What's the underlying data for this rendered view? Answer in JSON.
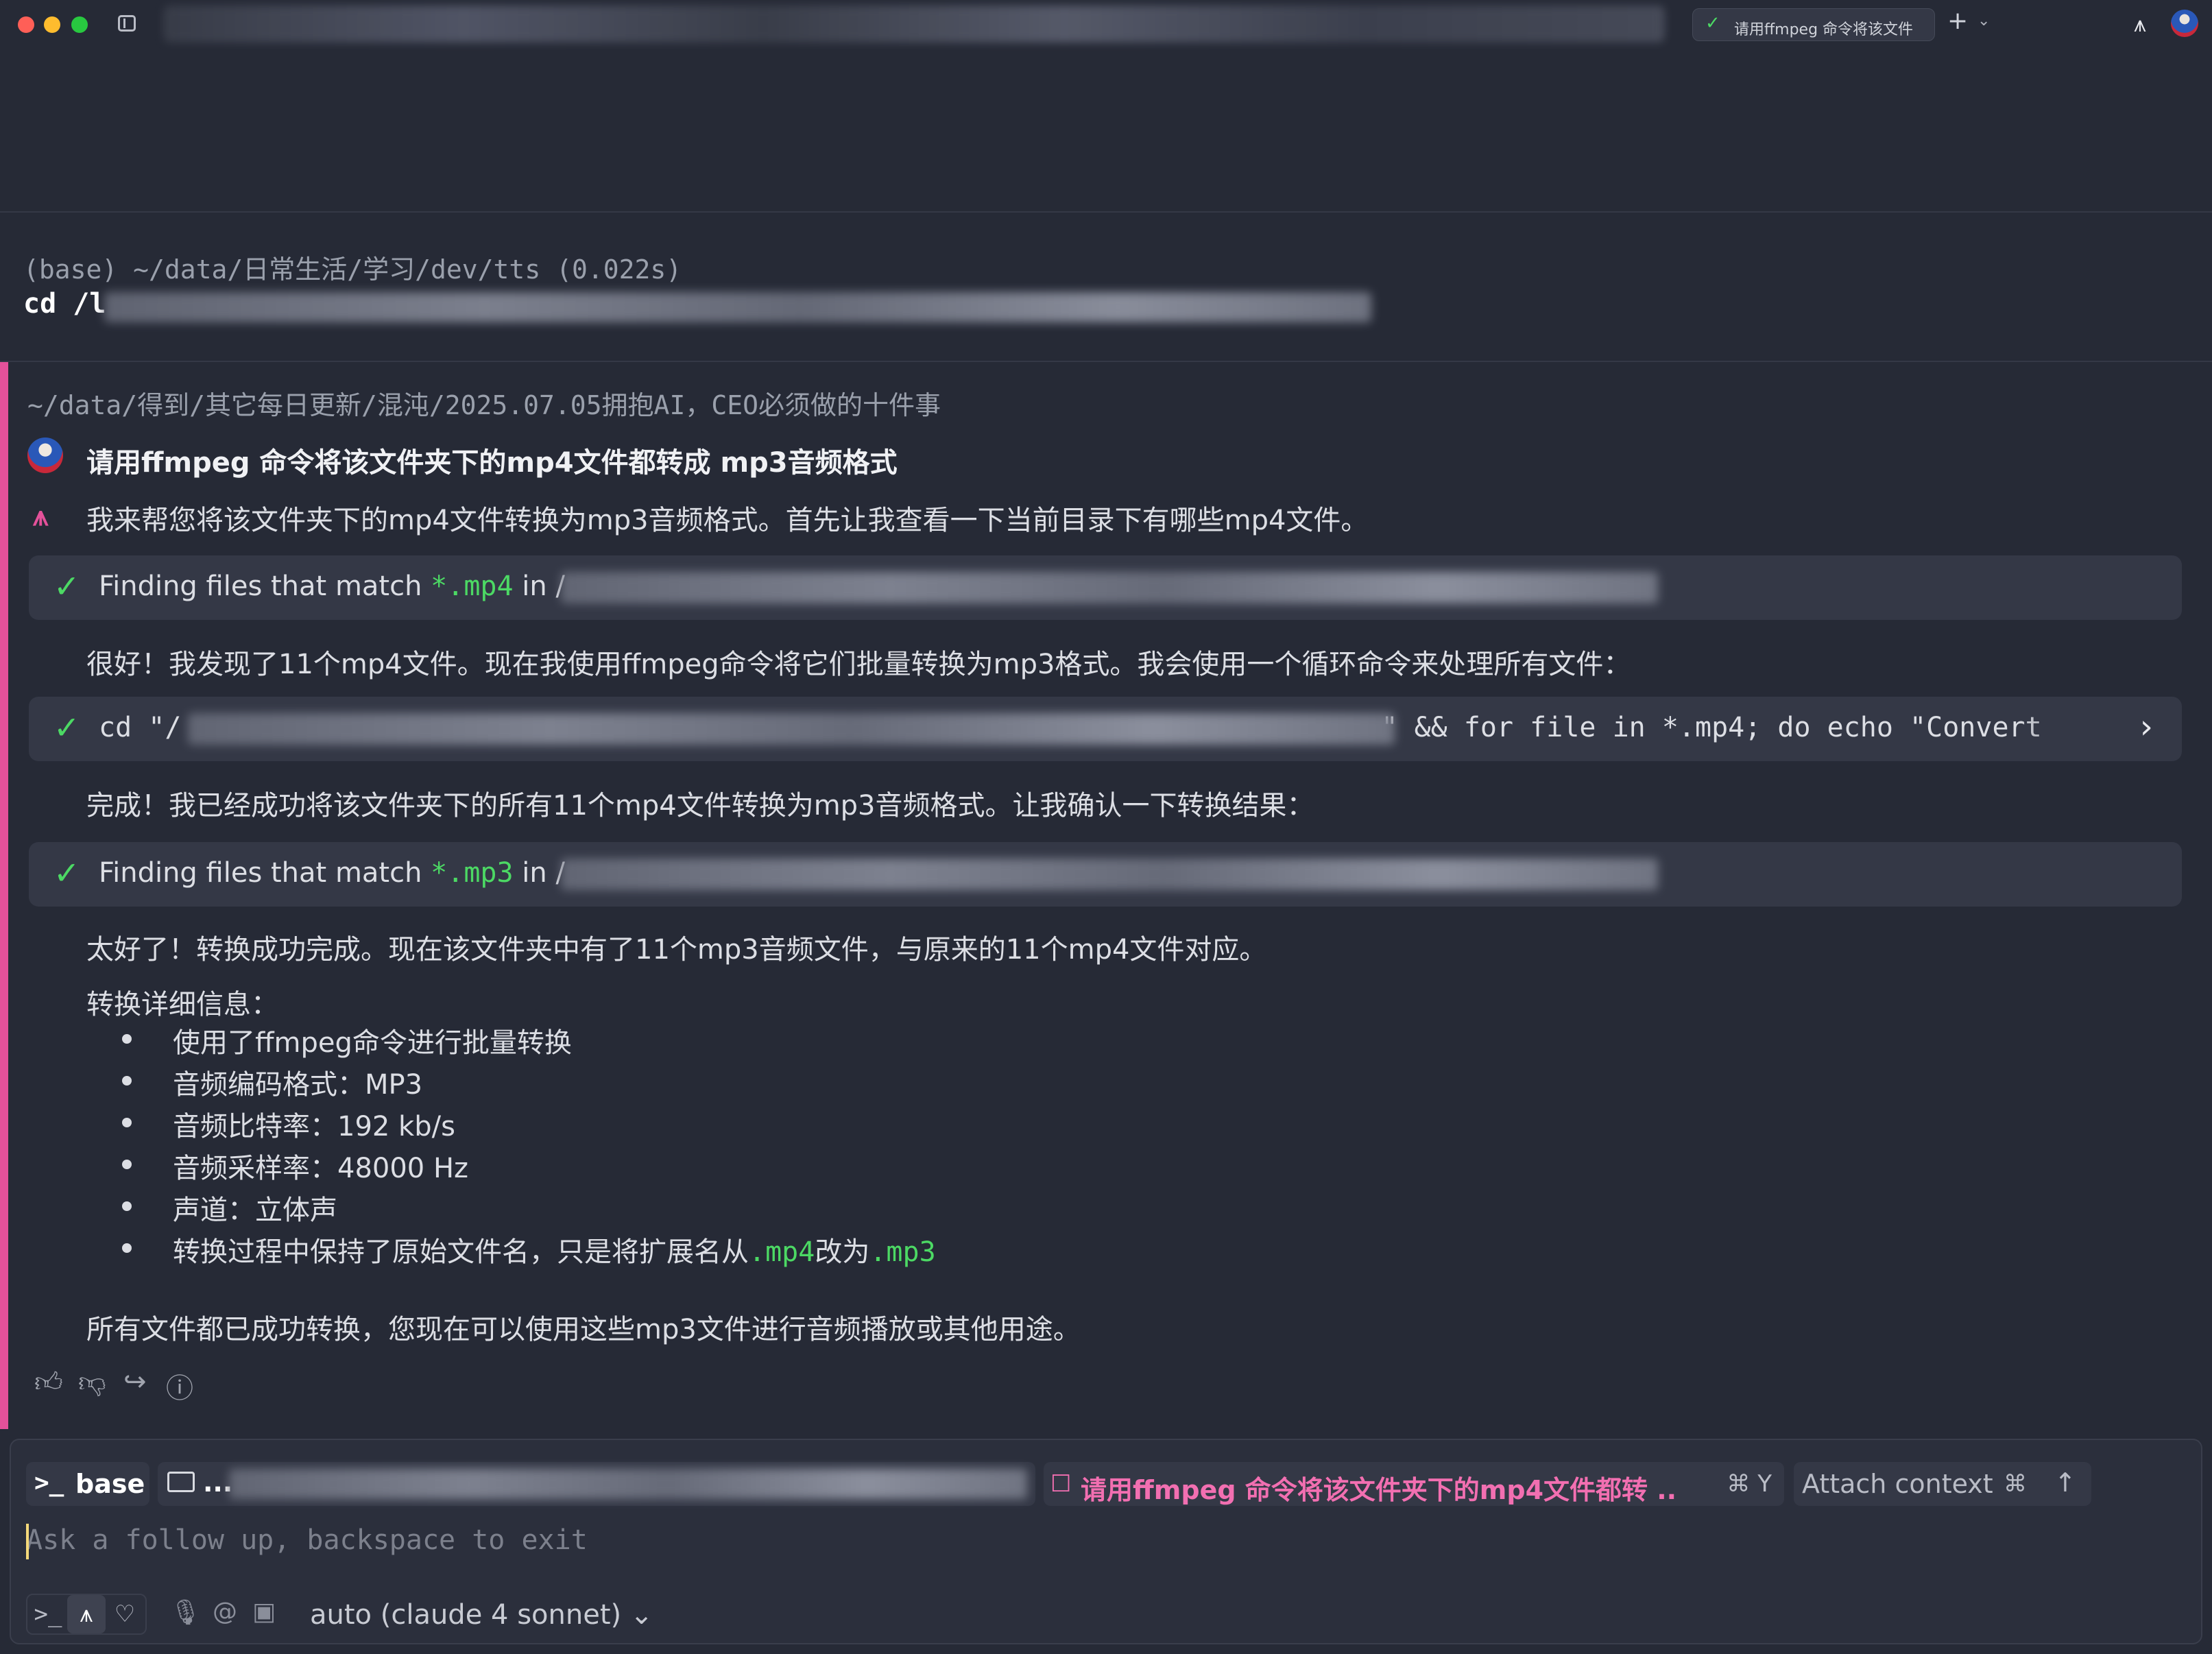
{
  "titlebar": {
    "active_tab_title": "请用ffmpeg 命令将该文件",
    "plus": "+",
    "chevron": "⌄",
    "app_logo": "⩚"
  },
  "previous_block": {
    "prompt_path": "(base) ~/data/日常生活/学习/dev/tts (0.022s)",
    "command": "cd /l"
  },
  "ai_block": {
    "cwd": "~/data/得到/其它每日更新/混沌/2025.07.05拥抱AI，CEO必须做的十件事",
    "user_query": "请用ffmpeg 命令将该文件夹下的mp4文件都转成 mp3音频格式",
    "agent_glyph": "⩚",
    "response_intro": "我来帮您将该文件夹下的mp4文件转换为mp3音频格式。首先让我查看一下当前目录下有哪些mp4文件。",
    "tool1": {
      "check": "✓",
      "prefix": "Finding files that match ",
      "pattern": "*.mp4",
      "mid": " in /"
    },
    "response_found": "很好！我发现了11个mp4文件。现在我使用ffmpeg命令将它们批量转换为mp3格式。我会使用一个循环命令来处理所有文件：",
    "tool2": {
      "check": "✓",
      "cmd_start": "cd \"/",
      "cmd_end": "\" && for file in *.mp4; do echo \"Convert",
      "chevron": "›"
    },
    "response_done": "完成！我已经成功将该文件夹下的所有11个mp4文件转换为mp3音频格式。让我确认一下转换结果：",
    "tool3": {
      "check": "✓",
      "prefix": "Finding files that match ",
      "pattern": "*.mp3",
      "mid": " in /"
    },
    "response_success": "太好了！转换成功完成。现在该文件夹中有了11个mp3音频文件，与原来的11个mp4文件对应。",
    "details_title": "转换详细信息：",
    "details": [
      "使用了ffmpeg命令进行批量转换",
      "音频编码格式：MP3",
      "音频比特率：192 kb/s",
      "音频采样率：48000 Hz",
      "声道：立体声"
    ],
    "detail_last": {
      "before": "转换过程中保持了原始文件名，只是将扩展名从",
      "ext1": ".mp4",
      "mid": "改为",
      "ext2": ".mp3"
    },
    "closing": "所有文件都已成功转换，您现在可以使用这些mp3文件进行音频播放或其他用途。",
    "feedback_icons": [
      "thumbs-up-icon",
      "thumbs-down-icon",
      "share-icon",
      "info-icon"
    ]
  },
  "input_panel": {
    "env_symbol": ">_",
    "env_label": "base",
    "dir_label": "...",
    "conversation_icon": "☐",
    "conversation_label": "请用ffmpeg 命令将该文件夹下的mp4文件都转 ...",
    "conversation_shortcut": "⌘ Y",
    "attach_label": "Attach context",
    "attach_shortcut": "⌘",
    "attach_up": "↑",
    "placeholder": "Ask a follow up, backspace to exit",
    "model_label": "auto (claude 4 sonnet)",
    "model_chevron": "⌄"
  },
  "colors": {
    "background": "#262a36",
    "accent_pink": "#e4519a",
    "success_green": "#4cd964",
    "card": "#343846"
  }
}
